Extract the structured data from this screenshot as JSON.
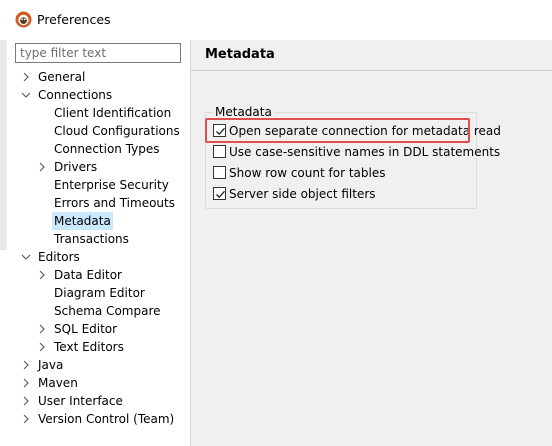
{
  "window": {
    "title": "Preferences"
  },
  "filter": {
    "placeholder": "type filter text",
    "value": ""
  },
  "tree": [
    {
      "label": "General",
      "expandable": true,
      "expanded": false,
      "level": 0
    },
    {
      "label": "Connections",
      "expandable": true,
      "expanded": true,
      "level": 0
    },
    {
      "label": "Client Identification",
      "expandable": false,
      "level": 1
    },
    {
      "label": "Cloud Configurations",
      "expandable": false,
      "level": 1
    },
    {
      "label": "Connection Types",
      "expandable": false,
      "level": 1
    },
    {
      "label": "Drivers",
      "expandable": true,
      "expanded": false,
      "level": 1
    },
    {
      "label": "Enterprise Security",
      "expandable": false,
      "level": 1
    },
    {
      "label": "Errors and Timeouts",
      "expandable": false,
      "level": 1
    },
    {
      "label": "Metadata",
      "expandable": false,
      "level": 1,
      "selected": true
    },
    {
      "label": "Transactions",
      "expandable": false,
      "level": 1
    },
    {
      "label": "Editors",
      "expandable": true,
      "expanded": true,
      "level": 0
    },
    {
      "label": "Data Editor",
      "expandable": true,
      "expanded": false,
      "level": 1
    },
    {
      "label": "Diagram Editor",
      "expandable": false,
      "level": 1
    },
    {
      "label": "Schema Compare",
      "expandable": false,
      "level": 1
    },
    {
      "label": "SQL Editor",
      "expandable": true,
      "expanded": false,
      "level": 1
    },
    {
      "label": "Text Editors",
      "expandable": true,
      "expanded": false,
      "level": 1
    },
    {
      "label": "Java",
      "expandable": true,
      "expanded": false,
      "level": 0
    },
    {
      "label": "Maven",
      "expandable": true,
      "expanded": false,
      "level": 0
    },
    {
      "label": "User Interface",
      "expandable": true,
      "expanded": false,
      "level": 0
    },
    {
      "label": "Version Control (Team)",
      "expandable": true,
      "expanded": false,
      "level": 0
    }
  ],
  "page": {
    "title": "Metadata",
    "group_label": "Metadata",
    "options": [
      {
        "label": "Open separate connection for metadata read",
        "checked": true
      },
      {
        "label": "Use case-sensitive names in DDL statements",
        "checked": false
      },
      {
        "label": "Show row count for tables",
        "checked": false
      },
      {
        "label": "Server side object filters",
        "checked": true
      }
    ]
  },
  "colors": {
    "selection": "#cce8ff",
    "highlight": "#e04e4e"
  }
}
